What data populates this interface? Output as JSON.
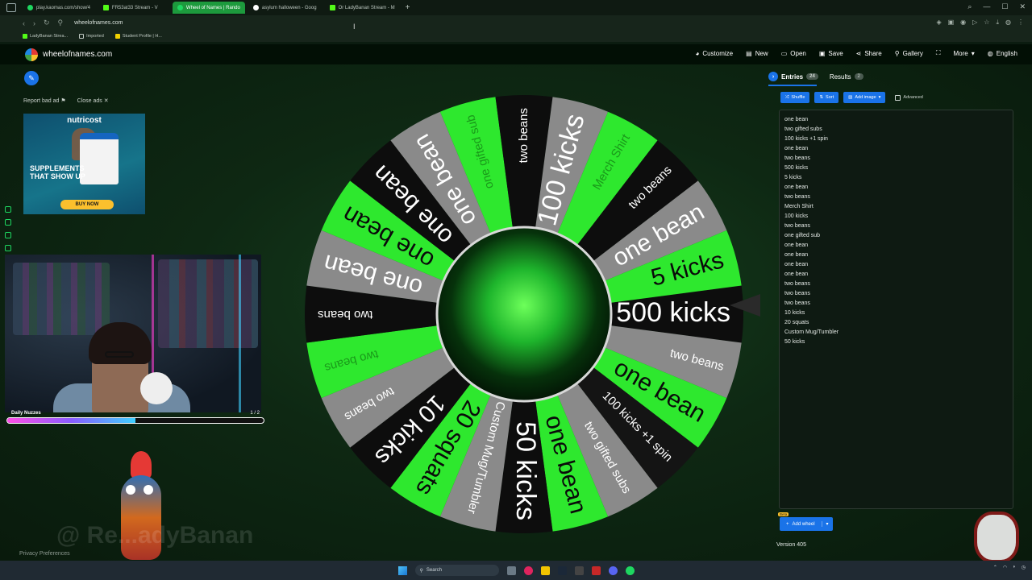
{
  "browser": {
    "tabs": [
      {
        "label": "play.kaomas.com/show/4",
        "active": false
      },
      {
        "label": "FR53at33 Stream - V",
        "active": false
      },
      {
        "label": "Wheel of Names | Rando",
        "active": true
      },
      {
        "label": "asylum halloween - Goog",
        "active": false
      },
      {
        "label": "Or LadyBanan Stream - M",
        "active": false
      }
    ],
    "new_tab": "+",
    "url": "wheelofnames.com",
    "bookmarks": [
      "LadyBanan Strea...",
      "Imported",
      "Student Profile | H..."
    ]
  },
  "site": {
    "title": "wheelofnames.com",
    "menu": [
      "Customize",
      "New",
      "Open",
      "Save",
      "Share",
      "Gallery",
      "",
      "More",
      "English"
    ]
  },
  "ads": {
    "report": "Report bad ad",
    "close": "Close ads",
    "brand": "nutricost",
    "headline": "SUPPLEMENTS THAT SHOW UP",
    "cta": "BUY NOW"
  },
  "stream": {
    "goal_label": "Daily Nuzzes",
    "goal_count": "1 / 2",
    "goal_progress": 0.5,
    "watermark": "@ Re...adyBanan",
    "privacy": "Privacy Preferences"
  },
  "panel": {
    "tab_entries": "Entries",
    "entries_count": "24",
    "tab_results": "Results",
    "results_count": "2",
    "shuffle": "Shuffle",
    "sort": "Sort",
    "add_image": "Add image",
    "advanced": "Advanced",
    "entries": [
      "one bean",
      "two gifted subs",
      "100 kicks +1 spin",
      "one bean",
      "two beans",
      "500 kicks",
      "5 kicks",
      "one bean",
      "two beans",
      "Merch Shirt",
      "100 kicks",
      "two beans",
      "one gifted sub",
      "one bean",
      "one bean",
      "one bean",
      "one bean",
      "two beans",
      "two beans",
      "two beans",
      "10 kicks",
      "20 squats",
      "Custom Mug/Tumbler",
      "50 kicks"
    ],
    "beta": "Beta",
    "add_wheel": "Add wheel",
    "version": "Version 405"
  },
  "wheel": {
    "segments": [
      {
        "label": "500 kicks",
        "color": "#0d0d0d",
        "size": "xl",
        "light": false
      },
      {
        "label": "two beans",
        "color": "#8a8a8a",
        "size": "sm",
        "light": false
      },
      {
        "label": "one bean",
        "color": "#2ee82e",
        "size": "lg",
        "light": false
      },
      {
        "label": "100 kicks +1 spin",
        "color": "#141414",
        "size": "sm",
        "light": false
      },
      {
        "label": "two gifted subs",
        "color": "#8a8a8a",
        "size": "sm",
        "light": false
      },
      {
        "label": "one bean",
        "color": "#2ee82e",
        "size": "lg",
        "light": false
      },
      {
        "label": "50 kicks",
        "color": "#0d0d0d",
        "size": "xl",
        "light": false
      },
      {
        "label": "Custom Mug/Tumbler",
        "color": "#8a8a8a",
        "size": "sm",
        "light": false
      },
      {
        "label": "20 squats",
        "color": "#2ee82e",
        "size": "lg",
        "light": false
      },
      {
        "label": "10 kicks",
        "color": "#0d0d0d",
        "size": "lg",
        "light": false
      },
      {
        "label": "two beans",
        "color": "#8a8a8a",
        "size": "sm",
        "light": false
      },
      {
        "label": "two beans",
        "color": "#2ee82e",
        "size": "sm",
        "light": true
      },
      {
        "label": "two beans",
        "color": "#0d0d0d",
        "size": "sm",
        "light": false
      },
      {
        "label": "one bean",
        "color": "#8a8a8a",
        "size": "lg",
        "light": false
      },
      {
        "label": "one bean",
        "color": "#2ee82e",
        "size": "lg",
        "light": false
      },
      {
        "label": "one bean",
        "color": "#0d0d0d",
        "size": "lg",
        "light": false
      },
      {
        "label": "one bean",
        "color": "#8a8a8a",
        "size": "lg",
        "light": false
      },
      {
        "label": "one gifted sub",
        "color": "#2ee82e",
        "size": "sm",
        "light": true
      },
      {
        "label": "two beans",
        "color": "#0d0d0d",
        "size": "sm",
        "light": false
      },
      {
        "label": "100 kicks",
        "color": "#8a8a8a",
        "size": "xl",
        "light": false
      },
      {
        "label": "Merch Shirt",
        "color": "#2ee82e",
        "size": "sm",
        "light": true
      },
      {
        "label": "two beans",
        "color": "#0d0d0d",
        "size": "sm",
        "light": false
      },
      {
        "label": "one bean",
        "color": "#8a8a8a",
        "size": "lg",
        "light": false
      },
      {
        "label": "5 kicks",
        "color": "#2ee82e",
        "size": "lg",
        "light": false
      }
    ]
  },
  "taskbar": {
    "search": "Search"
  }
}
